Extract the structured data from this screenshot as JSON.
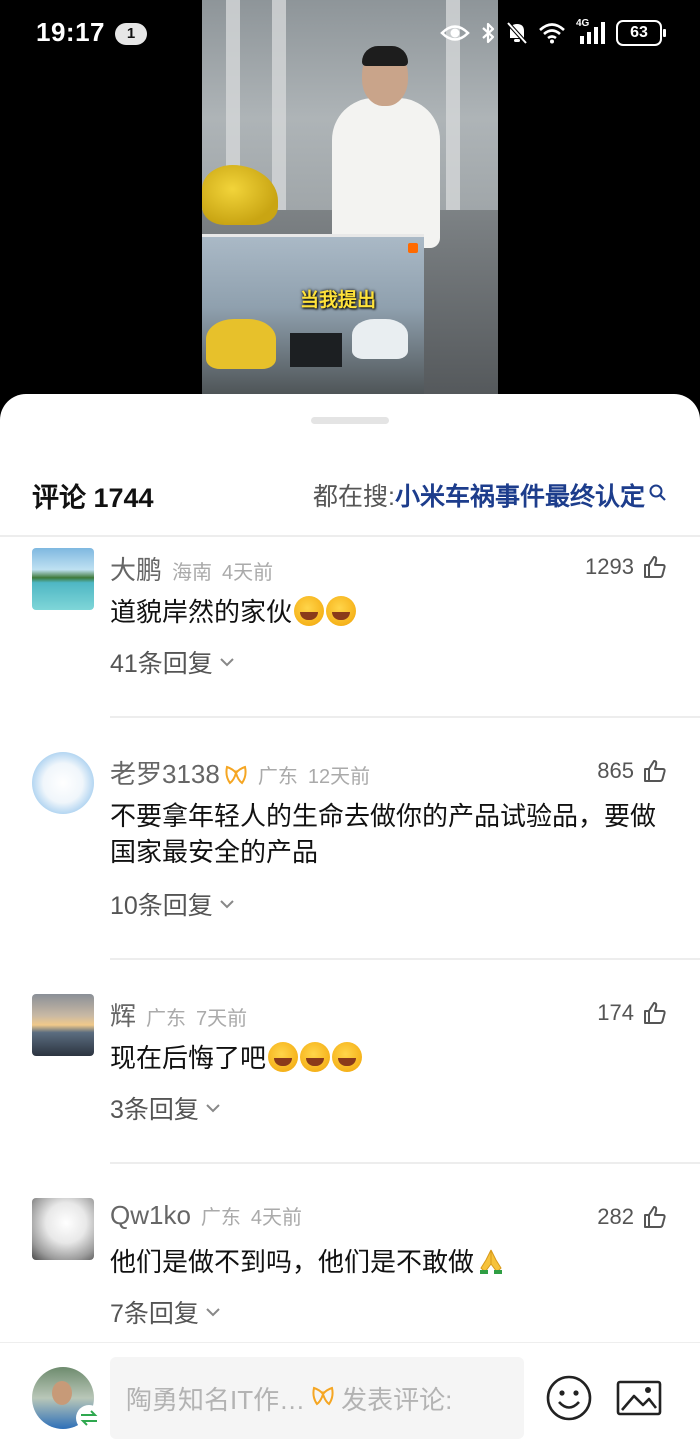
{
  "status_bar": {
    "time": "19:17",
    "notification_count": "1",
    "network": "4G",
    "battery": "63",
    "icons": [
      "eye-icon",
      "bluetooth-icon",
      "mute-bell-icon",
      "wifi-icon",
      "signal-icon",
      "battery-icon"
    ]
  },
  "video": {
    "caption": "当我提出"
  },
  "comments_panel": {
    "title": "评论 1744",
    "search_prefix": "都在搜: ",
    "search_term": "小米车祸事件最终认定",
    "comments": [
      {
        "user": "大鹏",
        "location": "海南",
        "time": "4天前",
        "likes": "1293",
        "text": "道貌岸然的家伙",
        "emojis": 2,
        "replies": "41条回复"
      },
      {
        "user": "老罗3138",
        "location": "广东",
        "time": "12天前",
        "likes": "865",
        "text": "不要拿年轻人的生命去做你的产品试验品，要做国家最安全的产品",
        "replies": "10条回复"
      },
      {
        "user": "辉",
        "location": "广东",
        "time": "7天前",
        "likes": "174",
        "text": "现在后悔了吧",
        "emojis": 3,
        "replies": "3条回复"
      },
      {
        "user": "Qw1ko",
        "location": "广东",
        "time": "4天前",
        "likes": "282",
        "text": "他们是做不到吗，他们是不敢做",
        "replies": "7条回复"
      }
    ]
  },
  "bottom_bar": {
    "input_placeholder": "陶勇知名IT作…",
    "input_suffix": "发表评论:"
  },
  "colors": {
    "search_term": "#1d3d8c",
    "badge_orange": "#f5a623"
  }
}
